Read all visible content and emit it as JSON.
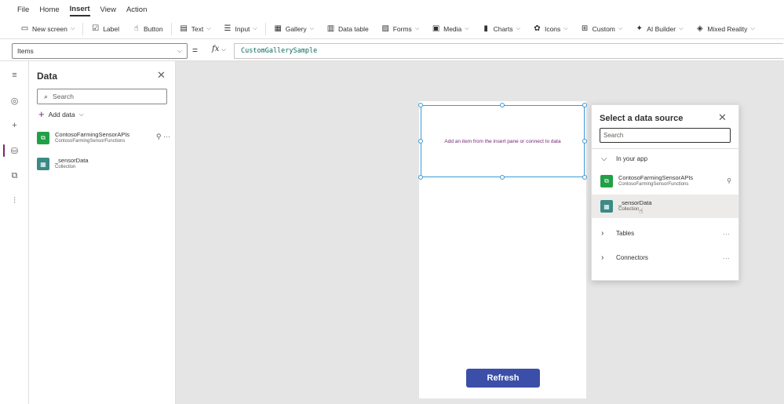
{
  "menu": [
    "File",
    "Home",
    "Insert",
    "View",
    "Action"
  ],
  "menu_active": "Insert",
  "ribbon": [
    {
      "label": "New screen",
      "icon": "new-screen-icon",
      "glyph": "▭",
      "chevron": true
    },
    {
      "label": "Label",
      "icon": "label-icon",
      "glyph": "☑",
      "chevron": false
    },
    {
      "label": "Button",
      "icon": "button-icon",
      "glyph": "☝",
      "chevron": false
    },
    {
      "label": "Text",
      "icon": "text-icon",
      "glyph": "▤",
      "chevron": true
    },
    {
      "label": "Input",
      "icon": "input-icon",
      "glyph": "☰",
      "chevron": true
    },
    {
      "label": "Gallery",
      "icon": "gallery-icon",
      "glyph": "▦",
      "chevron": true
    },
    {
      "label": "Data table",
      "icon": "data-table-icon",
      "glyph": "▥",
      "chevron": false
    },
    {
      "label": "Forms",
      "icon": "forms-icon",
      "glyph": "▨",
      "chevron": true
    },
    {
      "label": "Media",
      "icon": "media-icon",
      "glyph": "▣",
      "chevron": true
    },
    {
      "label": "Charts",
      "icon": "charts-icon",
      "glyph": "▮",
      "chevron": true
    },
    {
      "label": "Icons",
      "icon": "icons-icon",
      "glyph": "✿",
      "chevron": true
    },
    {
      "label": "Custom",
      "icon": "custom-icon",
      "glyph": "⊞",
      "chevron": true
    },
    {
      "label": "AI Builder",
      "icon": "ai-builder-icon",
      "glyph": "✦",
      "chevron": true
    },
    {
      "label": "Mixed Reality",
      "icon": "mixed-reality-icon",
      "glyph": "◈",
      "chevron": true
    }
  ],
  "formula_bar": {
    "property": "Items",
    "eq": "=",
    "fx": "fx",
    "formula": "CustomGallerySample"
  },
  "rail": [
    {
      "name": "hamburger-icon",
      "glyph": "≡"
    },
    {
      "name": "tree-view-icon",
      "glyph": "◎"
    },
    {
      "name": "insert-icon",
      "glyph": "+"
    },
    {
      "name": "data-icon",
      "glyph": "⛁",
      "active": true
    },
    {
      "name": "media-icon",
      "glyph": "⧉"
    },
    {
      "name": "advanced-tools-icon",
      "glyph": "⫶"
    }
  ],
  "data_pane": {
    "title": "Data",
    "close_glyph": "✕",
    "search_placeholder": "Search",
    "add_data": "Add data",
    "sources": [
      {
        "name": "ContosoFarmingSensorAPIs",
        "sub": "ContosoFarmingSensorFunctions",
        "type": "connector",
        "trailing": "⚲  ···"
      },
      {
        "name": "_sensorData",
        "sub": "Collection",
        "type": "collection"
      }
    ]
  },
  "canvas": {
    "gallery_hint": "Add an item from the insert pane or connect to data",
    "refresh_button": "Refresh"
  },
  "flyout": {
    "title": "Select a data source",
    "close_glyph": "✕",
    "search_placeholder": "Search",
    "in_your_app": "In your app",
    "items": [
      {
        "name": "ContosoFarmingSensorAPIs",
        "sub": "ContosoFarmingSensorFunctions",
        "type": "connector"
      },
      {
        "name": "_sensorData",
        "sub": "Collection",
        "type": "collection",
        "hover": true
      }
    ],
    "tables": "Tables",
    "connectors": "Connectors",
    "more": "···"
  },
  "colors": {
    "accent": "#742774",
    "selection": "#3a9bd8",
    "refresh": "#3b4fa8",
    "connector_icon": "#22a047",
    "collection_icon": "#3a8a85"
  }
}
